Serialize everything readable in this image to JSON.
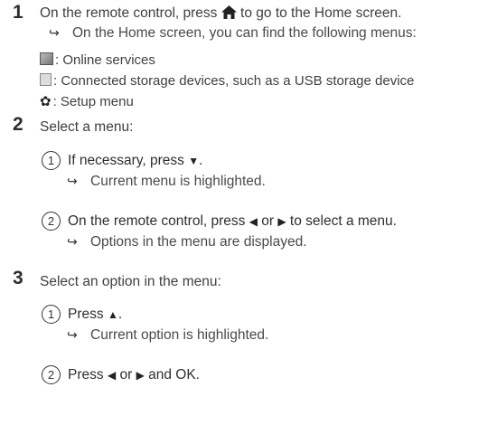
{
  "step1": {
    "number": "1",
    "text_before": "On the remote control, press ",
    "home_icon": "home-icon",
    "text_after": " to go to the Home screen.",
    "result_arrow": "↪",
    "result": "On the Home screen, you can find the following menus:",
    "menus": [
      {
        "icon": "online-services-icon",
        "label": ": Online services"
      },
      {
        "icon": "storage-icon",
        "label": ": Connected storage devices, such as a USB storage device"
      },
      {
        "icon": "gear-icon",
        "label": ": Setup menu"
      }
    ]
  },
  "step2": {
    "number": "2",
    "text": "Select a menu:",
    "sub1": {
      "marker": "1",
      "text": "If necessary, press ",
      "key": "▼",
      "end": ".",
      "result": "Current menu is highlighted."
    },
    "sub2": {
      "marker": "2",
      "text1": "On the remote control, press ",
      "key1": "◀",
      "mid": " or ",
      "key2": "▶",
      "text2": " to select a menu.",
      "result": "Options in the menu are displayed."
    }
  },
  "step3": {
    "number": "3",
    "text": "Select an option in the menu:",
    "sub1": {
      "marker": "1",
      "text": "Press ",
      "key": "▲",
      "end": ".",
      "result": "Current option is highlighted."
    },
    "sub2": {
      "marker": "2",
      "text1": "Press ",
      "key1": "◀",
      "mid": " or ",
      "key2": "▶",
      "text2": " and OK."
    }
  }
}
